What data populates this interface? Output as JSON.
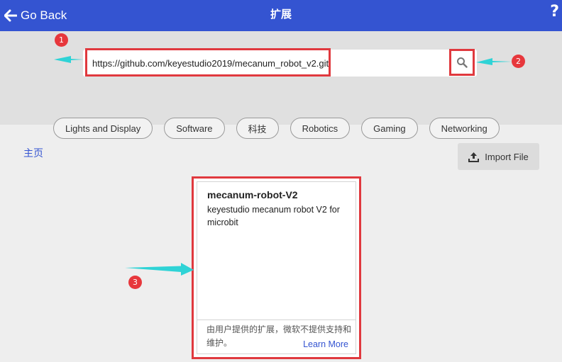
{
  "header": {
    "back_label": "Go Back",
    "title": "扩展",
    "help_symbol": "?",
    "back_icon": "arrow-left-icon",
    "bg_color": "#3454d1"
  },
  "search": {
    "value": "https://github.com/keyestudio2019/mecanum_robot_v2.git",
    "button_icon": "search-icon"
  },
  "categories": [
    "Lights and Display",
    "Software",
    "科技",
    "Robotics",
    "Gaming",
    "Networking"
  ],
  "home_link": "主页",
  "import_button": {
    "label": "Import File",
    "icon": "upload-icon"
  },
  "extension_card": {
    "title": "mecanum-robot-V2",
    "description": "keyestudio mecanum robot V2 for microbit",
    "note": "由用户提供的扩展，微软不提供支持和维护。",
    "learn_more": "Learn More"
  },
  "annotations": {
    "markers": [
      "1",
      "2",
      "3"
    ],
    "marker_color": "#e7373c",
    "highlight_color": "#e0393e",
    "arrow_color": "#2fd3d6"
  }
}
